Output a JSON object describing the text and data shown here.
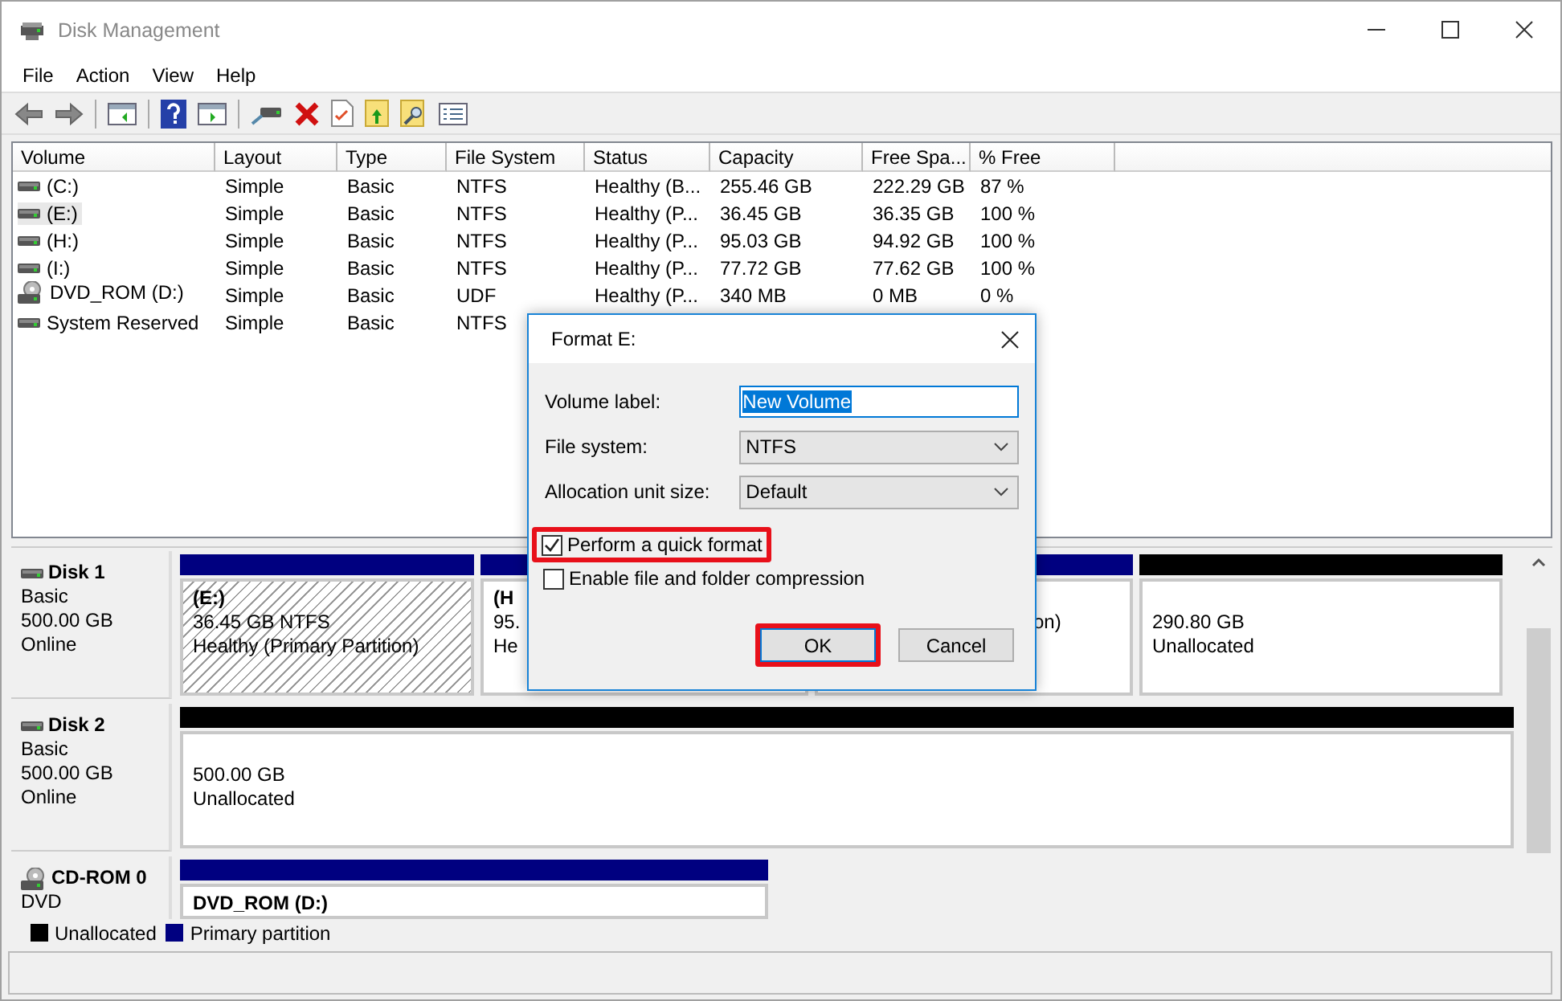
{
  "window": {
    "title": "Disk Management"
  },
  "menu": [
    "File",
    "Action",
    "View",
    "Help"
  ],
  "volumes": {
    "columns": [
      "Volume",
      "Layout",
      "Type",
      "File System",
      "Status",
      "Capacity",
      "Free Spa...",
      "% Free"
    ],
    "rows": [
      {
        "kind": "disk",
        "selected": false,
        "cells": [
          "(C:)",
          "Simple",
          "Basic",
          "NTFS",
          "Healthy (B...",
          "255.46 GB",
          "222.29 GB",
          "87 %"
        ]
      },
      {
        "kind": "disk",
        "selected": true,
        "cells": [
          "(E:)",
          "Simple",
          "Basic",
          "NTFS",
          "Healthy (P...",
          "36.45 GB",
          "36.35 GB",
          "100 %"
        ]
      },
      {
        "kind": "disk",
        "selected": false,
        "cells": [
          "(H:)",
          "Simple",
          "Basic",
          "NTFS",
          "Healthy (P...",
          "95.03 GB",
          "94.92 GB",
          "100 %"
        ]
      },
      {
        "kind": "disk",
        "selected": false,
        "cells": [
          "(I:)",
          "Simple",
          "Basic",
          "NTFS",
          "Healthy (P...",
          "77.72 GB",
          "77.62 GB",
          "100 %"
        ]
      },
      {
        "kind": "cd",
        "selected": false,
        "cells": [
          "DVD_ROM (D:)",
          "Simple",
          "Basic",
          "UDF",
          "Healthy (P...",
          "340 MB",
          "0 MB",
          "0 %"
        ]
      },
      {
        "kind": "disk",
        "selected": false,
        "cells": [
          "System Reserved",
          "Simple",
          "Basic",
          "NTFS"
        ]
      }
    ]
  },
  "disks": [
    {
      "kind": "disk",
      "name": "Disk 1",
      "lines": [
        "Basic",
        "500.00 GB",
        "Online"
      ],
      "partitions": [
        {
          "kind": "primary",
          "selected": true,
          "title": "(E:)",
          "lines": [
            "36.45 GB NTFS",
            "Healthy (Primary Partition)"
          ]
        },
        {
          "kind": "primary",
          "selected": false,
          "title": "(H",
          "lines": [
            "95.",
            "He"
          ]
        },
        {
          "kind": "primary",
          "selected": false,
          "lines": [
            "on)"
          ]
        },
        {
          "kind": "unallocated",
          "selected": false,
          "lines": [
            "290.80 GB",
            "Unallocated"
          ]
        }
      ]
    },
    {
      "kind": "disk",
      "name": "Disk 2",
      "lines": [
        "Basic",
        "500.00 GB",
        "Online"
      ],
      "partitions": [
        {
          "kind": "unallocated",
          "selected": false,
          "lines": [
            "500.00 GB",
            "Unallocated"
          ]
        }
      ]
    },
    {
      "kind": "cd",
      "name": "CD-ROM 0",
      "lines": [
        "DVD"
      ],
      "partitions": [
        {
          "kind": "primary",
          "selected": false,
          "title": "DVD_ROM (D:)"
        }
      ]
    }
  ],
  "legend": [
    {
      "label": "Unallocated",
      "color": "#000000"
    },
    {
      "label": "Primary partition",
      "color": "#000080"
    }
  ],
  "dialog": {
    "title": "Format E:",
    "fields": [
      {
        "kind": "text",
        "label": "Volume label:",
        "value": "New Volume"
      },
      {
        "kind": "select",
        "label": "File system:",
        "value": "NTFS"
      },
      {
        "kind": "select",
        "label": "Allocation unit size:",
        "value": "Default"
      }
    ],
    "checkboxes": [
      {
        "label": "Perform a quick format",
        "checked": true,
        "highlighted": true
      },
      {
        "label": "Enable file and folder compression",
        "checked": false,
        "highlighted": false
      }
    ],
    "buttons": [
      {
        "label": "OK",
        "highlighted": true
      },
      {
        "label": "Cancel",
        "highlighted": false
      }
    ]
  }
}
